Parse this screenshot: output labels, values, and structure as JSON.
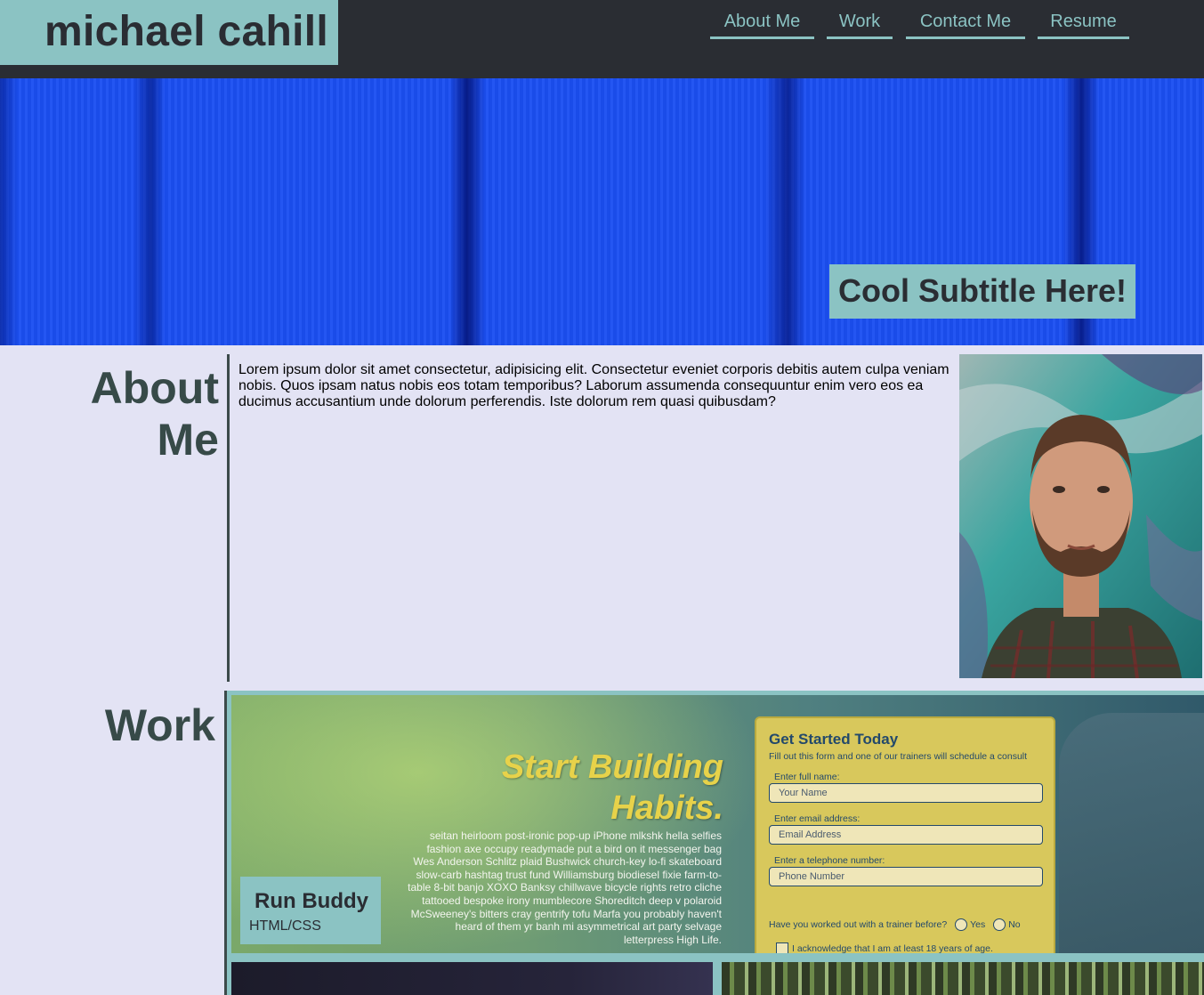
{
  "header": {
    "logo": "michael cahill",
    "nav": [
      {
        "label": "About Me"
      },
      {
        "label": "Work"
      },
      {
        "label": "Contact Me"
      },
      {
        "label": "Resume"
      }
    ]
  },
  "hero": {
    "subtitle": "Cool Subtitle Here!"
  },
  "about": {
    "title": "About Me",
    "text": "Lorem ipsum dolor sit amet consectetur, adipisicing elit. Consectetur eveniet corporis debitis autem culpa veniam nobis. Quos ipsam natus nobis eos totam temporibus? Laborum assumenda consequuntur enim vero eos ea ducimus accusantium unde dolorum perferendis. Iste dolorum rem quasi quibusdam?"
  },
  "work": {
    "title": "Work",
    "featured": {
      "name": "Run Buddy",
      "tech": "HTML/CSS",
      "screenshot": {
        "headline_1": "Start Building",
        "headline_2": "Habits.",
        "body": "seitan heirloom post-ironic pop-up iPhone mlkshk hella selfies fashion axe occupy readymade put a bird on it messenger bag Wes Anderson Schlitz plaid Bushwick church-key lo-fi skateboard slow-carb hashtag trust fund Williamsburg biodiesel fixie farm-to-table 8-bit banjo XOXO Banksy chillwave bicycle rights retro cliche tattooed bespoke irony mumblecore Shoreditch deep v polaroid McSweeney's bitters cray gentrify tofu Marfa you probably haven't heard of them yr banh mi asymmetrical art party selvage letterpress High Life.",
        "form": {
          "heading": "Get Started Today",
          "subheading": "Fill out this form and one of our trainers will schedule a consult",
          "name_label": "Enter full name:",
          "name_placeholder": "Your Name",
          "email_label": "Enter email address:",
          "email_placeholder": "Email Address",
          "phone_label": "Enter a telephone number:",
          "phone_placeholder": "Phone Number",
          "question": "Have you worked out with a trainer before?",
          "yes": "Yes",
          "no": "No",
          "ack": "I acknowledge that I am at least 18 years of age."
        }
      }
    }
  },
  "colors": {
    "accent": "#8bc3c3",
    "header_bg": "#2a2d33",
    "page_bg": "#e3e3f4",
    "hero_blue": "#1b4ff2"
  }
}
